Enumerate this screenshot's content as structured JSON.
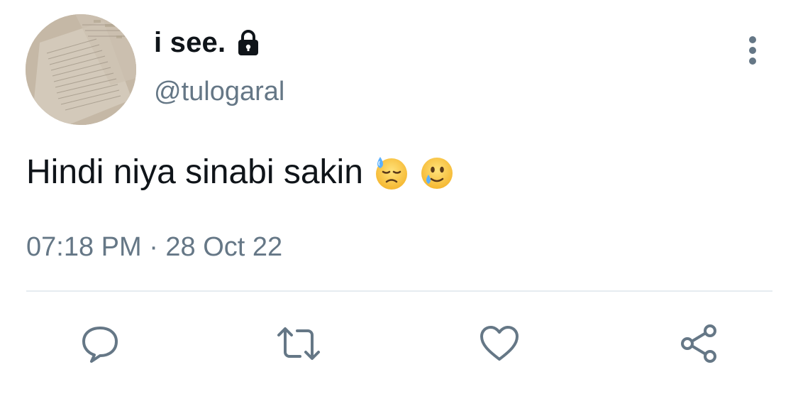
{
  "tweet": {
    "display_name": "i see.",
    "handle": "@tulogaral",
    "text": "Hindi niya sinabi sakin",
    "emojis": [
      "downcast-face-with-sweat",
      "smiling-face-with-tear"
    ],
    "timestamp": "07:18 PM · 28 Oct 22",
    "protected": true
  },
  "actions": [
    {
      "name": "reply",
      "icon": "speech-bubble-icon"
    },
    {
      "name": "retweet",
      "icon": "retweet-icon"
    },
    {
      "name": "like",
      "icon": "heart-icon"
    },
    {
      "name": "share",
      "icon": "share-icon"
    }
  ],
  "colors": {
    "text": "#0f1419",
    "secondary": "#657786",
    "divider": "#e6ecf0",
    "background": "#ffffff"
  }
}
